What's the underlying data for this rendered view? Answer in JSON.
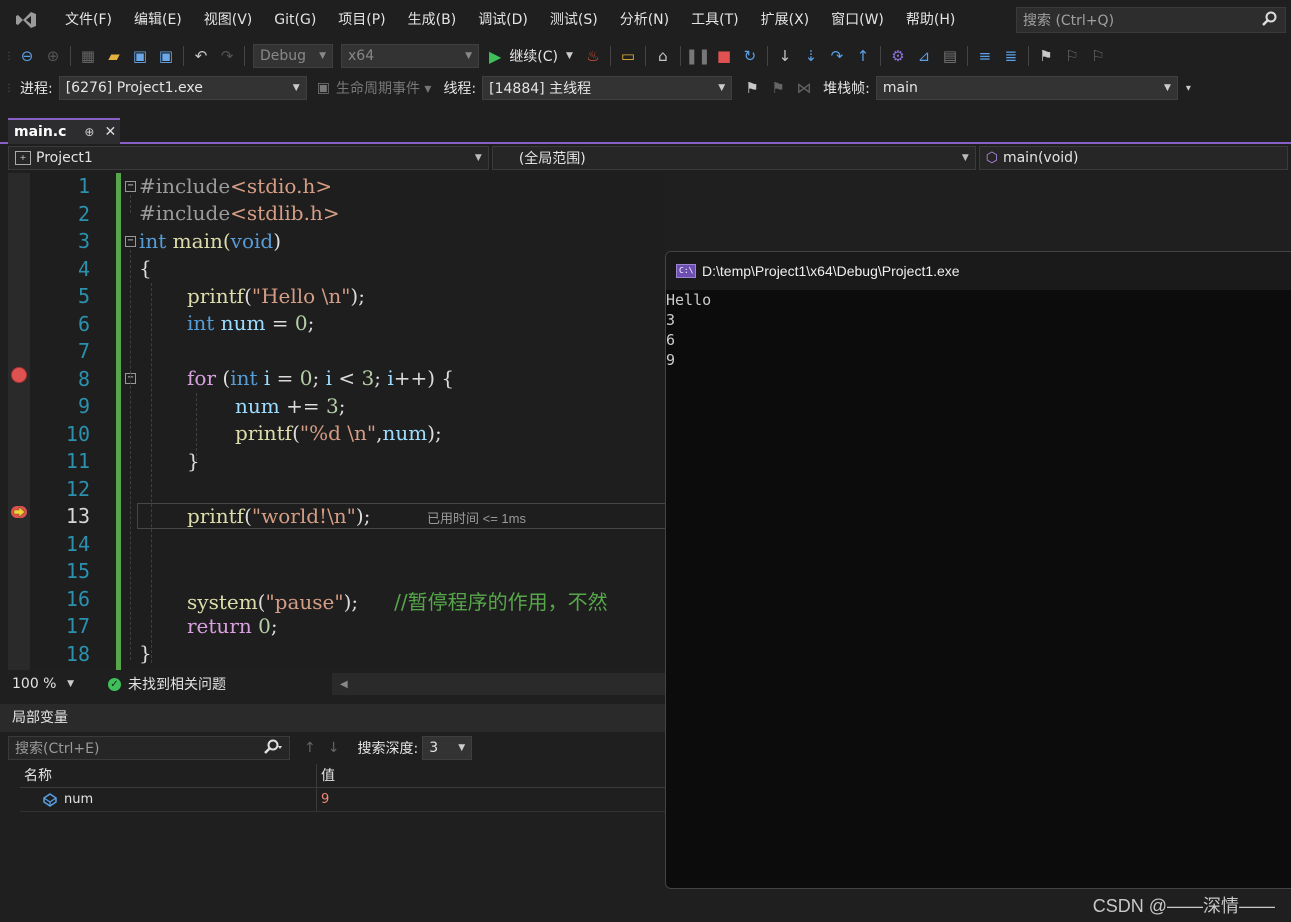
{
  "menu": {
    "items": [
      "文件(F)",
      "编辑(E)",
      "视图(V)",
      "Git(G)",
      "项目(P)",
      "生成(B)",
      "调试(D)",
      "测试(S)",
      "分析(N)",
      "工具(T)",
      "扩展(X)",
      "窗口(W)",
      "帮助(H)"
    ],
    "search_placeholder": "搜索 (Ctrl+Q)"
  },
  "toolbar": {
    "config": "Debug",
    "platform": "x64",
    "continue_label": "继续(C)"
  },
  "debug_bar": {
    "process_label": "进程:",
    "process_value": "[6276] Project1.exe",
    "lifecycle_label": "生命周期事件",
    "thread_label": "线程:",
    "thread_value": "[14884] 主线程",
    "stack_label": "堆栈帧:",
    "stack_value": "main"
  },
  "tab": {
    "filename": "main.c",
    "pin": "⊕",
    "close": "✕"
  },
  "navbar": {
    "project": "Project1",
    "scope": "(全局范围)",
    "member": "main(void)"
  },
  "editor": {
    "line_numbers": [
      "1",
      "2",
      "3",
      "4",
      "5",
      "6",
      "7",
      "8",
      "9",
      "10",
      "11",
      "12",
      "13",
      "14",
      "15",
      "16",
      "17",
      "18"
    ],
    "current_line": 13,
    "breakpoint_line": 8,
    "elapsed": "已用时间 <= 1ms",
    "lines": {
      "l1_a": "#include",
      "l1_b": "<stdio.h>",
      "l2_a": "#include",
      "l2_b": "<stdlib.h>",
      "l3_a": "int",
      "l3_b": " main(",
      "l3_c": "void",
      "l3_d": ")",
      "l4": "{",
      "l5_a": "printf",
      "l5_b": "(",
      "l5_c": "\"Hello \\n\"",
      "l5_d": ");",
      "l6_a": "int",
      "l6_b": " num",
      "l6_c": " = ",
      "l6_d": "0",
      "l6_e": ";",
      "l8_a": "for",
      "l8_b": " (",
      "l8_c": "int",
      "l8_d": " i",
      "l8_e": " = ",
      "l8_f": "0",
      "l8_g": "; ",
      "l8_h": "i",
      "l8_i": " < ",
      "l8_j": "3",
      "l8_k": "; ",
      "l8_l": "i",
      "l8_m": "++) {",
      "l9_a": "num",
      "l9_b": " += ",
      "l9_c": "3",
      "l9_d": ";",
      "l10_a": "printf",
      "l10_b": "(",
      "l10_c": "\"%d \\n\"",
      "l10_d": ",",
      "l10_e": "num",
      "l10_f": ");",
      "l11": "}",
      "l13_a": "printf",
      "l13_b": "(",
      "l13_c": "\"world!\\n\"",
      "l13_d": ");",
      "l16_a": "system",
      "l16_b": "(",
      "l16_c": "\"pause\"",
      "l16_d": ");",
      "l16_e": "//暂停程序的作用，不然",
      "l17_a": "return",
      "l17_b": " ",
      "l17_c": "0",
      "l17_d": ";",
      "l18": "}"
    }
  },
  "status": {
    "zoom": "100 %",
    "issues": "未找到相关问题"
  },
  "locals": {
    "title": "局部变量",
    "search_placeholder": "搜索(Ctrl+E)",
    "depth_label": "搜索深度:",
    "depth_value": "3",
    "col_name": "名称",
    "col_value": "值",
    "rows": [
      {
        "name": "num",
        "value": "9"
      }
    ]
  },
  "console": {
    "title": "D:\\temp\\Project1\\x64\\Debug\\Project1.exe",
    "icon_text": "C:\\",
    "output": [
      "Hello",
      "3",
      "6",
      "9"
    ]
  },
  "watermark": "CSDN @——深情——",
  "colors": {
    "accent": "#8860c8",
    "breakpoint": "#e05252",
    "changebar": "#57a64a",
    "keyword": "#569cd6",
    "string": "#d69d85"
  }
}
